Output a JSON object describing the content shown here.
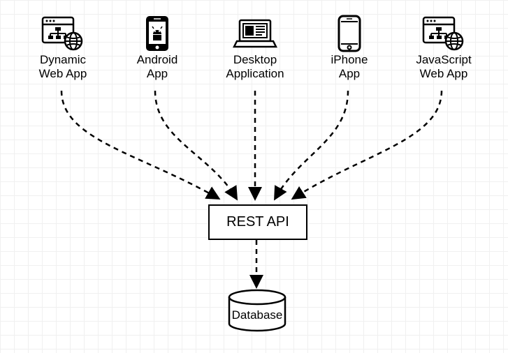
{
  "clients": [
    {
      "label1": "Dynamic",
      "label2": "Web App"
    },
    {
      "label1": "Android",
      "label2": "App"
    },
    {
      "label1": "Desktop",
      "label2": "Application"
    },
    {
      "label1": "iPhone",
      "label2": "App"
    },
    {
      "label1": "JavaScript",
      "label2": "Web App"
    }
  ],
  "rest": {
    "label": "REST API"
  },
  "database": {
    "label": "Database"
  }
}
